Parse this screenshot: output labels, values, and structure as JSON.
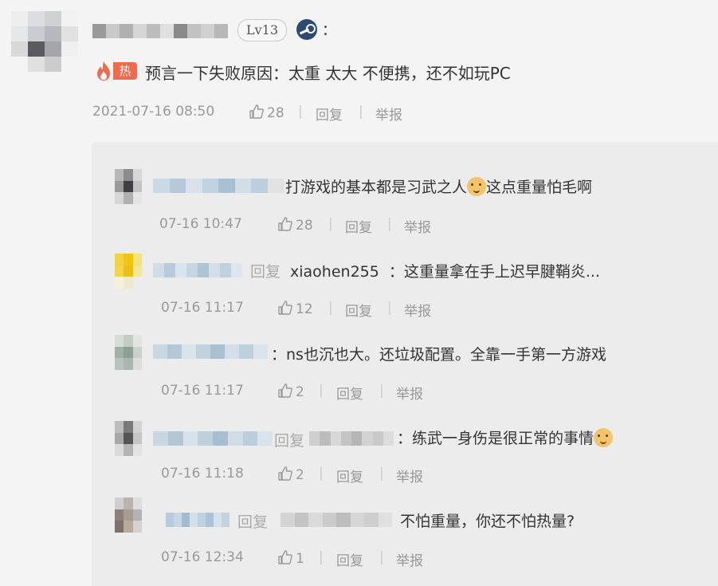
{
  "main": {
    "level": "Lv13",
    "colon": "：",
    "hot_label": "热",
    "text": "预言一下失败原因：太重 太大 不便携，还不如玩PC",
    "timestamp": "2021-07-16 08:50",
    "likes": "28",
    "reply_label": "回复",
    "report_label": "举报"
  },
  "replies": [
    {
      "text": "打游戏的基本都是习武之人",
      "text_after": "这点重量怕毛啊",
      "time": "07-16 10:47",
      "likes": "28"
    },
    {
      "prefix": "回复",
      "target": "xiaohen255",
      "text": "：这重量拿在手上迟早腱鞘炎...",
      "time": "07-16 11:17",
      "likes": "12"
    },
    {
      "text": "：ns也沉也大。还垃圾配置。全靠一手第一方游戏",
      "time": "07-16 11:17",
      "likes": "2"
    },
    {
      "prefix": "回复",
      "text": "：练武一身伤是很正常的事情",
      "time": "07-16 11:18",
      "likes": "2"
    },
    {
      "prefix": "回复",
      "text": "不怕重量，你还不怕热量?",
      "time": "07-16 12:34",
      "likes": "1"
    }
  ],
  "actions": {
    "reply": "回复",
    "report": "举报"
  },
  "colors": {
    "hot": "#f06a4e",
    "text": "#333333",
    "meta": "#999999",
    "reply_bg": "#ececec",
    "steam": "#2b4c6f"
  },
  "icons": [
    "steam-icon",
    "fire-icon",
    "thumb-up-icon",
    "dog-emoji-icon"
  ]
}
